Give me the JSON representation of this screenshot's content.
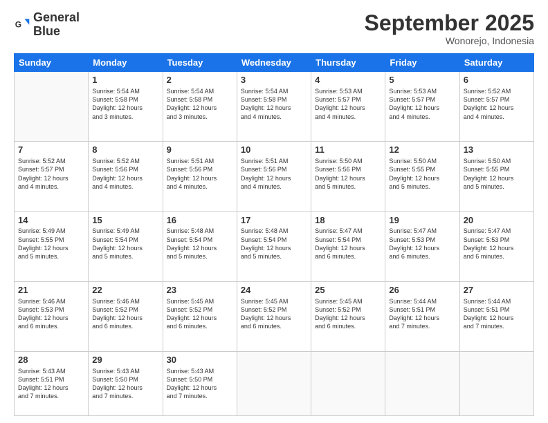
{
  "header": {
    "logo_line1": "General",
    "logo_line2": "Blue",
    "month": "September 2025",
    "location": "Wonorejo, Indonesia"
  },
  "days": [
    "Sunday",
    "Monday",
    "Tuesday",
    "Wednesday",
    "Thursday",
    "Friday",
    "Saturday"
  ],
  "weeks": [
    [
      {
        "day": "",
        "info": ""
      },
      {
        "day": "1",
        "info": "Sunrise: 5:54 AM\nSunset: 5:58 PM\nDaylight: 12 hours\nand 3 minutes."
      },
      {
        "day": "2",
        "info": "Sunrise: 5:54 AM\nSunset: 5:58 PM\nDaylight: 12 hours\nand 3 minutes."
      },
      {
        "day": "3",
        "info": "Sunrise: 5:54 AM\nSunset: 5:58 PM\nDaylight: 12 hours\nand 4 minutes."
      },
      {
        "day": "4",
        "info": "Sunrise: 5:53 AM\nSunset: 5:57 PM\nDaylight: 12 hours\nand 4 minutes."
      },
      {
        "day": "5",
        "info": "Sunrise: 5:53 AM\nSunset: 5:57 PM\nDaylight: 12 hours\nand 4 minutes."
      },
      {
        "day": "6",
        "info": "Sunrise: 5:52 AM\nSunset: 5:57 PM\nDaylight: 12 hours\nand 4 minutes."
      }
    ],
    [
      {
        "day": "7",
        "info": "Sunrise: 5:52 AM\nSunset: 5:57 PM\nDaylight: 12 hours\nand 4 minutes."
      },
      {
        "day": "8",
        "info": "Sunrise: 5:52 AM\nSunset: 5:56 PM\nDaylight: 12 hours\nand 4 minutes."
      },
      {
        "day": "9",
        "info": "Sunrise: 5:51 AM\nSunset: 5:56 PM\nDaylight: 12 hours\nand 4 minutes."
      },
      {
        "day": "10",
        "info": "Sunrise: 5:51 AM\nSunset: 5:56 PM\nDaylight: 12 hours\nand 4 minutes."
      },
      {
        "day": "11",
        "info": "Sunrise: 5:50 AM\nSunset: 5:56 PM\nDaylight: 12 hours\nand 5 minutes."
      },
      {
        "day": "12",
        "info": "Sunrise: 5:50 AM\nSunset: 5:55 PM\nDaylight: 12 hours\nand 5 minutes."
      },
      {
        "day": "13",
        "info": "Sunrise: 5:50 AM\nSunset: 5:55 PM\nDaylight: 12 hours\nand 5 minutes."
      }
    ],
    [
      {
        "day": "14",
        "info": "Sunrise: 5:49 AM\nSunset: 5:55 PM\nDaylight: 12 hours\nand 5 minutes."
      },
      {
        "day": "15",
        "info": "Sunrise: 5:49 AM\nSunset: 5:54 PM\nDaylight: 12 hours\nand 5 minutes."
      },
      {
        "day": "16",
        "info": "Sunrise: 5:48 AM\nSunset: 5:54 PM\nDaylight: 12 hours\nand 5 minutes."
      },
      {
        "day": "17",
        "info": "Sunrise: 5:48 AM\nSunset: 5:54 PM\nDaylight: 12 hours\nand 5 minutes."
      },
      {
        "day": "18",
        "info": "Sunrise: 5:47 AM\nSunset: 5:54 PM\nDaylight: 12 hours\nand 6 minutes."
      },
      {
        "day": "19",
        "info": "Sunrise: 5:47 AM\nSunset: 5:53 PM\nDaylight: 12 hours\nand 6 minutes."
      },
      {
        "day": "20",
        "info": "Sunrise: 5:47 AM\nSunset: 5:53 PM\nDaylight: 12 hours\nand 6 minutes."
      }
    ],
    [
      {
        "day": "21",
        "info": "Sunrise: 5:46 AM\nSunset: 5:53 PM\nDaylight: 12 hours\nand 6 minutes."
      },
      {
        "day": "22",
        "info": "Sunrise: 5:46 AM\nSunset: 5:52 PM\nDaylight: 12 hours\nand 6 minutes."
      },
      {
        "day": "23",
        "info": "Sunrise: 5:45 AM\nSunset: 5:52 PM\nDaylight: 12 hours\nand 6 minutes."
      },
      {
        "day": "24",
        "info": "Sunrise: 5:45 AM\nSunset: 5:52 PM\nDaylight: 12 hours\nand 6 minutes."
      },
      {
        "day": "25",
        "info": "Sunrise: 5:45 AM\nSunset: 5:52 PM\nDaylight: 12 hours\nand 6 minutes."
      },
      {
        "day": "26",
        "info": "Sunrise: 5:44 AM\nSunset: 5:51 PM\nDaylight: 12 hours\nand 7 minutes."
      },
      {
        "day": "27",
        "info": "Sunrise: 5:44 AM\nSunset: 5:51 PM\nDaylight: 12 hours\nand 7 minutes."
      }
    ],
    [
      {
        "day": "28",
        "info": "Sunrise: 5:43 AM\nSunset: 5:51 PM\nDaylight: 12 hours\nand 7 minutes."
      },
      {
        "day": "29",
        "info": "Sunrise: 5:43 AM\nSunset: 5:50 PM\nDaylight: 12 hours\nand 7 minutes."
      },
      {
        "day": "30",
        "info": "Sunrise: 5:43 AM\nSunset: 5:50 PM\nDaylight: 12 hours\nand 7 minutes."
      },
      {
        "day": "",
        "info": ""
      },
      {
        "day": "",
        "info": ""
      },
      {
        "day": "",
        "info": ""
      },
      {
        "day": "",
        "info": ""
      }
    ]
  ]
}
